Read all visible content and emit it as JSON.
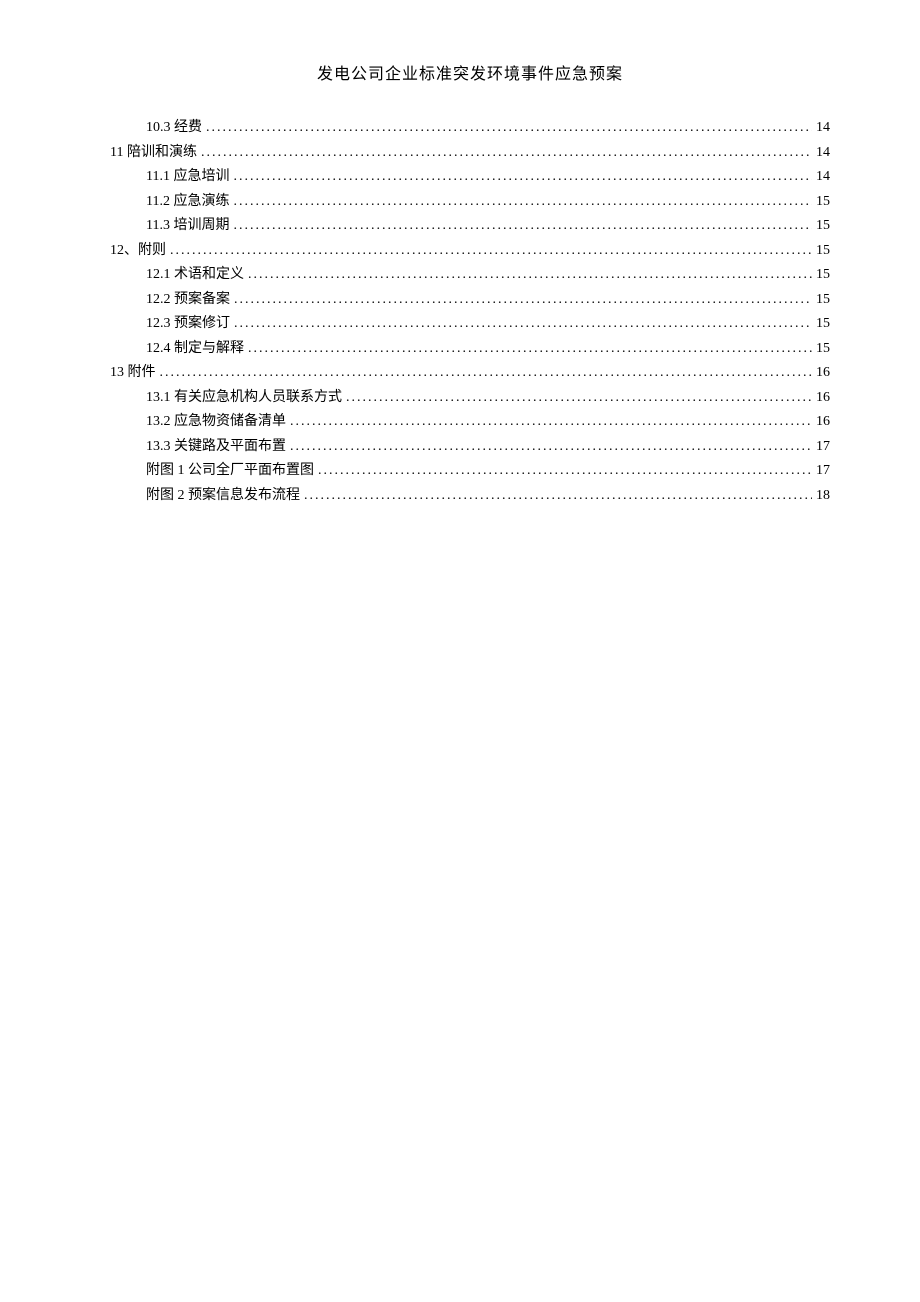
{
  "title": "发电公司企业标准突发环境事件应急预案",
  "toc": [
    {
      "level": 2,
      "label": "10.3 经费",
      "page": "14"
    },
    {
      "level": 1,
      "label": "11 陪训和演练",
      "page": "14"
    },
    {
      "level": 2,
      "label": "11.1 应急培训",
      "page": "14"
    },
    {
      "level": 2,
      "label": "11.2 应急演练",
      "page": "15"
    },
    {
      "level": 2,
      "label": "11.3 培训周期",
      "page": "15"
    },
    {
      "level": 1,
      "label": "12、附则",
      "page": "15"
    },
    {
      "level": 2,
      "label": "12.1 术语和定义",
      "page": "15"
    },
    {
      "level": 2,
      "label": "12.2 预案备案",
      "page": "15"
    },
    {
      "level": 2,
      "label": "12.3 预案修订",
      "page": "15"
    },
    {
      "level": 2,
      "label": "12.4 制定与解释",
      "page": "15"
    },
    {
      "level": 1,
      "label": "13 附件",
      "page": "16"
    },
    {
      "level": 2,
      "label": "13.1 有关应急机构人员联系方式",
      "page": "16"
    },
    {
      "level": 2,
      "label": "13.2 应急物资储备清单",
      "page": "16"
    },
    {
      "level": 2,
      "label": "13.3 关键路及平面布置",
      "page": "17"
    },
    {
      "level": 2,
      "label": "附图 1 公司全厂平面布置图",
      "page": "17"
    },
    {
      "level": 2,
      "label": "附图 2 预案信息发布流程",
      "page": "18"
    }
  ]
}
